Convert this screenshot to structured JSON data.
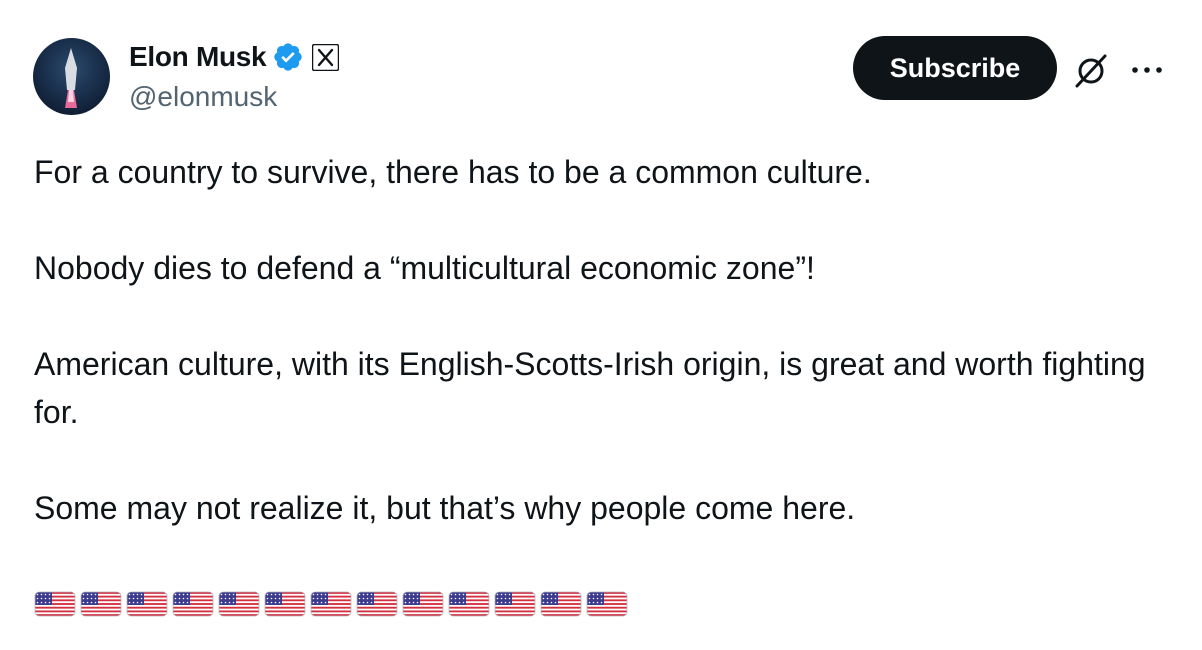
{
  "author": {
    "display_name": "Elon Musk",
    "handle": "@elonmusk",
    "verified_icon": "verified-badge-icon",
    "affiliation_icon": "x-logo-icon"
  },
  "actions": {
    "subscribe_label": "Subscribe",
    "grok_icon": "grok-icon",
    "more_icon": "more-options-icon"
  },
  "tweet": {
    "paragraphs": [
      "For a country to survive, there has to be a common culture.",
      "Nobody dies to defend a “multicultural economic zone”!",
      "American culture, with its English-Scotts-Irish origin, is great and worth fighting for.",
      "Some may not realize it, but that’s why people come here."
    ],
    "emoji_flags": {
      "icon": "us-flag-icon",
      "count": 13
    }
  },
  "colors": {
    "text": "#0f1419",
    "secondary_text": "#536471",
    "button_bg": "#0f1419",
    "verified_blue": "#1d9bf0"
  }
}
